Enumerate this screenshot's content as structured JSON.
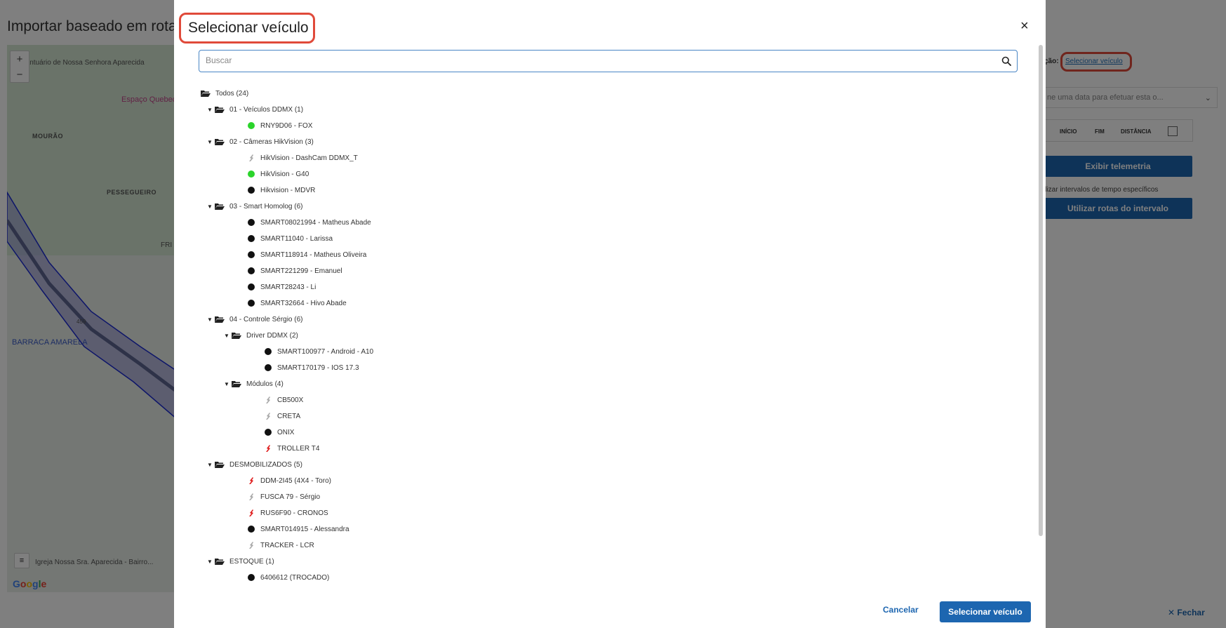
{
  "background": {
    "page_title": "Importar baseado em rota",
    "map": {
      "zoom_in": "+",
      "zoom_out": "−",
      "labels": [
        "Santuário de Nossa Senhora Aparecida",
        "Espaço Quebec",
        "MOURÃO",
        "PESSEGUEIRO",
        "FRI",
        "BARRACA AMARELA",
        "459",
        "Igreja Nossa Sra. Aparecida - Bairro..."
      ],
      "google_logo": "Google"
    },
    "right_panel": {
      "vehicle_label": "ção:",
      "vehicle_link": "Selecionar veículo",
      "date_select_placeholder": "ne uma data para efetuar esta o...",
      "table_headers": [
        "INÍCIO",
        "FIM",
        "DISTÂNCIA"
      ],
      "telemetry_button": "Exibir telemetria",
      "interval_note": "ilizar intervalos de tempo específicos",
      "interval_button": "Utilizar rotas do intervalo",
      "close_label": "✕ Fechar"
    }
  },
  "modal": {
    "title": "Selecionar veículo",
    "close_icon": "×",
    "search_placeholder": "Buscar",
    "tree": [
      {
        "level": 0,
        "kind": "folder",
        "caret": false,
        "label": "Todos (24)"
      },
      {
        "level": 1,
        "kind": "folder",
        "caret": true,
        "label": "01 - Veículos DDMX (1)"
      },
      {
        "level": 2,
        "kind": "green",
        "label": "RNY9D06 - FOX"
      },
      {
        "level": 1,
        "kind": "folder",
        "caret": true,
        "label": "02 - Câmeras HikVision (3)"
      },
      {
        "level": 2,
        "kind": "plug",
        "label": "HikVision - DashCam DDMX_T"
      },
      {
        "level": 2,
        "kind": "green",
        "label": "HikVision - G40"
      },
      {
        "level": 2,
        "kind": "black",
        "label": "Hikvision - MDVR"
      },
      {
        "level": 1,
        "kind": "folder",
        "caret": true,
        "label": "03 - Smart Homolog (6)"
      },
      {
        "level": 2,
        "kind": "black",
        "label": "SMART08021994 - Matheus Abade"
      },
      {
        "level": 2,
        "kind": "black",
        "label": "SMART11040 - Larissa"
      },
      {
        "level": 2,
        "kind": "black",
        "label": "SMART118914 - Matheus Oliveira"
      },
      {
        "level": 2,
        "kind": "black",
        "label": "SMART221299 - Emanuel"
      },
      {
        "level": 2,
        "kind": "black",
        "label": "SMART28243 - Li"
      },
      {
        "level": 2,
        "kind": "black",
        "label": "SMART32664 - Hivo Abade"
      },
      {
        "level": 1,
        "kind": "folder",
        "caret": true,
        "label": "04 - Controle Sérgio (6)"
      },
      {
        "level": 2,
        "kind": "folder",
        "caret": true,
        "label": "Driver DDMX (2)"
      },
      {
        "level": 3,
        "kind": "black",
        "label": "SMART100977 - Android - A10"
      },
      {
        "level": 3,
        "kind": "black",
        "label": "SMART170179 - IOS 17.3"
      },
      {
        "level": 2,
        "kind": "folder",
        "caret": true,
        "label": "Módulos (4)"
      },
      {
        "level": 3,
        "kind": "plug",
        "label": "CB500X"
      },
      {
        "level": 3,
        "kind": "plug",
        "label": "CRETA"
      },
      {
        "level": 3,
        "kind": "black",
        "label": "ONIX"
      },
      {
        "level": 3,
        "kind": "redplug",
        "label": "TROLLER T4"
      },
      {
        "level": 1,
        "kind": "folder",
        "caret": true,
        "label": "DESMOBILIZADOS (5)"
      },
      {
        "level": 2,
        "kind": "redplug",
        "label": "DDM-2I45 (4X4 - Toro)"
      },
      {
        "level": 2,
        "kind": "plug",
        "label": "FUSCA 79 - Sérgio"
      },
      {
        "level": 2,
        "kind": "redplug",
        "label": "RUS6F90 - CRONOS"
      },
      {
        "level": 2,
        "kind": "black",
        "label": "SMART014915 - Alessandra"
      },
      {
        "level": 2,
        "kind": "plug",
        "label": "TRACKER - LCR"
      },
      {
        "level": 1,
        "kind": "folder",
        "caret": true,
        "label": "ESTOQUE (1)"
      },
      {
        "level": 2,
        "kind": "black",
        "label": "6406612 (TROCADO)"
      }
    ],
    "cancel_label": "Cancelar",
    "select_label": "Selecionar veículo"
  },
  "colors": {
    "primary": "#1d66b0",
    "highlight": "#e04a3a",
    "online": "#2bd42b",
    "offline": "#111111",
    "alert": "#e02020"
  }
}
